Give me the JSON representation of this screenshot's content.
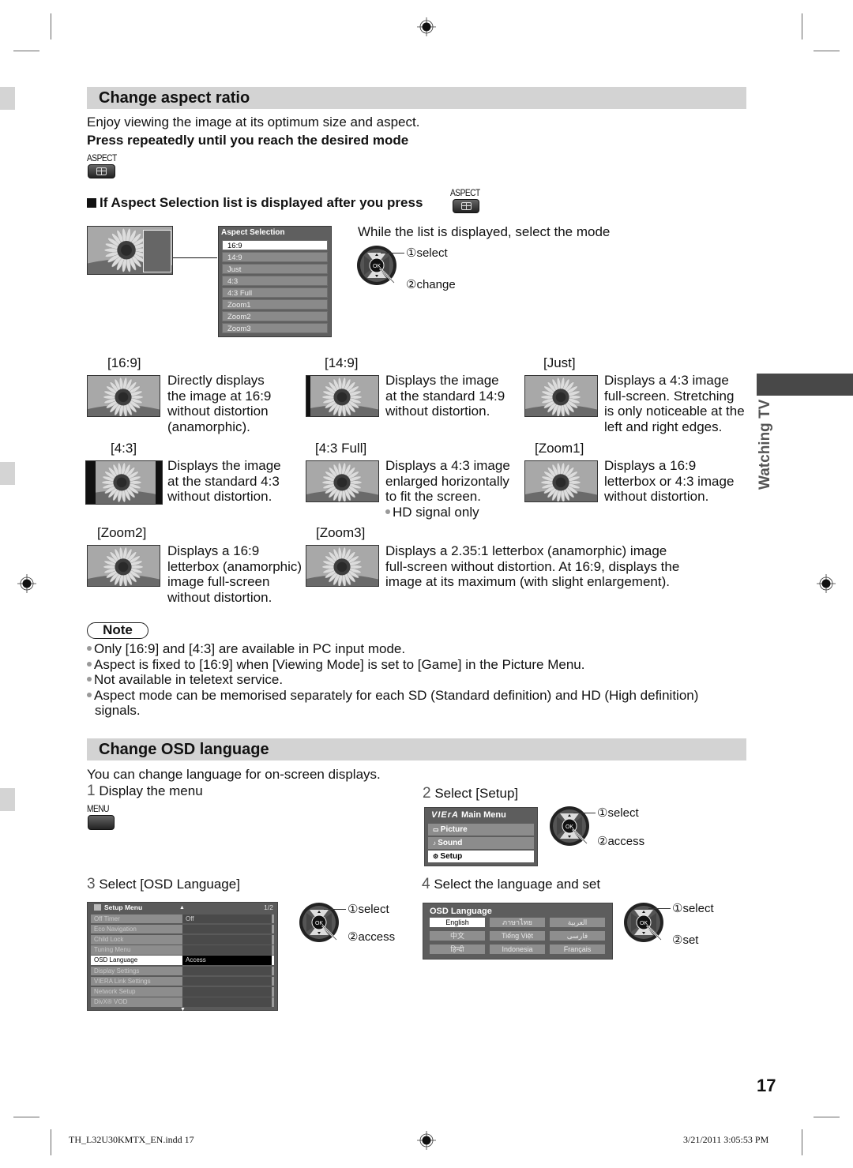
{
  "aspect_section": {
    "title": "Change aspect ratio",
    "intro": "Enjoy viewing the image at its optimum size and aspect.",
    "instruction": "Press repeatedly until you reach the desired mode",
    "key_label": "ASPECT",
    "key_icon": "aspect-key-icon",
    "subheading": "If Aspect Selection list is displayed after you press",
    "subheading_key_label": "ASPECT",
    "list_hint": "While the list is displayed, select the mode",
    "dpad_steps": [
      "①select",
      "②change"
    ],
    "menu": {
      "title": "Aspect Selection",
      "items": [
        "16:9",
        "14:9",
        "Just",
        "4:3",
        "4:3 Full",
        "Zoom1",
        "Zoom2",
        "Zoom3"
      ],
      "selected_index": 0
    },
    "modes": [
      {
        "label": "[16:9]",
        "desc": [
          "Directly displays",
          "the image at 16:9",
          "without distortion",
          "(anamorphic)."
        ]
      },
      {
        "label": "[14:9]",
        "desc": [
          "Displays the image",
          "at the standard 14:9",
          "without distortion."
        ]
      },
      {
        "label": "[Just]",
        "desc": [
          "Displays a 4:3 image",
          "full-screen. Stretching",
          "is only noticeable at the",
          "left and right edges."
        ]
      },
      {
        "label": "[4:3]",
        "desc": [
          "Displays the image",
          "at the standard 4:3",
          "without distortion."
        ]
      },
      {
        "label": "[4:3 Full]",
        "desc": [
          "Displays a 4:3 image",
          "enlarged horizontally",
          "to fit the screen."
        ],
        "note": "HD signal only"
      },
      {
        "label": "[Zoom1]",
        "desc": [
          "Displays a 16:9",
          "letterbox or 4:3 image",
          "without distortion."
        ]
      },
      {
        "label": "[Zoom2]",
        "desc": [
          "Displays a 16:9",
          "letterbox (anamorphic)",
          "image full-screen",
          "without distortion."
        ]
      },
      {
        "label": "[Zoom3]",
        "desc": [
          "Displays a 2.35:1 letterbox (anamorphic) image",
          "full-screen without distortion. At 16:9, displays the",
          "image at its maximum (with slight enlargement)."
        ]
      }
    ]
  },
  "note": {
    "badge": "Note",
    "items": [
      "Only [16:9] and [4:3] are available in PC input mode.",
      "Aspect is fixed to [16:9] when [Viewing Mode] is set to [Game] in the Picture Menu.",
      "Not available in teletext service.",
      "Aspect mode can be memorised separately for each SD (Standard definition) and HD (High definition)",
      "signals."
    ]
  },
  "osd_section": {
    "title": "Change OSD language",
    "intro": "You can change language for on-screen displays.",
    "steps": [
      {
        "num": "1",
        "text": "Display the menu",
        "key_label": "MENU"
      },
      {
        "num": "2",
        "text": "Select [Setup]",
        "dpad_steps": [
          "①select",
          "②access"
        ]
      },
      {
        "num": "3",
        "text": "Select [OSD Language]",
        "dpad_steps": [
          "①select",
          "②access"
        ]
      },
      {
        "num": "4",
        "text": "Select the language and set",
        "dpad_steps": [
          "①select",
          "②set"
        ]
      }
    ],
    "main_menu": {
      "brand": "VIErA",
      "title": "Main Menu",
      "items": [
        "Picture",
        "Sound",
        "Setup"
      ],
      "selected_index": 2
    },
    "setup_menu": {
      "title": "Setup Menu",
      "page": "1/2",
      "rows": [
        {
          "label": "Off Timer",
          "value": "Off"
        },
        {
          "label": "Eco Navigation",
          "value": ""
        },
        {
          "label": "Child Lock",
          "value": ""
        },
        {
          "label": "Tuning Menu",
          "value": ""
        },
        {
          "label": "OSD Language",
          "value": "Access"
        },
        {
          "label": "Display Settings",
          "value": ""
        },
        {
          "label": "VIERA Link Settings",
          "value": ""
        },
        {
          "label": "Network Setup",
          "value": ""
        },
        {
          "label": "DivX® VOD",
          "value": ""
        }
      ],
      "selected_index": 4
    },
    "language_menu": {
      "title": "OSD Language",
      "options": [
        "English",
        "ภาษาไทย",
        "العربية",
        "中文",
        "Tiếng Việt",
        "فارسی",
        "हिन्दी",
        "Indonesia",
        "Français"
      ],
      "selected_index": 0
    }
  },
  "side_tab": {
    "label": "Watching TV"
  },
  "page_number": "17",
  "footer": {
    "file": "TH_L32U30KMTX_EN.indd   17",
    "timestamp": "3/21/2011   3:05:53 PM"
  }
}
